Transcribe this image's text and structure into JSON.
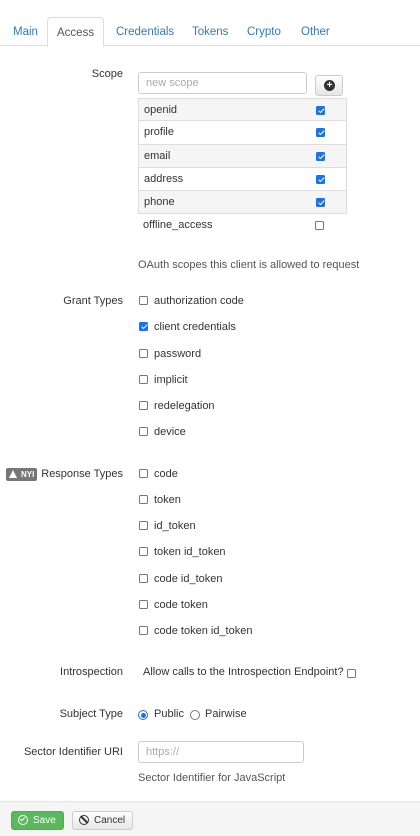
{
  "tabs": [
    {
      "label": "Main",
      "active": false
    },
    {
      "label": "Access",
      "active": true
    },
    {
      "label": "Credentials",
      "active": false
    },
    {
      "label": "Tokens",
      "active": false
    },
    {
      "label": "Crypto",
      "active": false
    },
    {
      "label": "Other",
      "active": false
    }
  ],
  "scope": {
    "label": "Scope",
    "placeholder": "new scope",
    "items": [
      {
        "name": "openid",
        "checked": true
      },
      {
        "name": "profile",
        "checked": true
      },
      {
        "name": "email",
        "checked": true
      },
      {
        "name": "address",
        "checked": true
      },
      {
        "name": "phone",
        "checked": true
      },
      {
        "name": "offline_access",
        "checked": false
      }
    ],
    "help": "OAuth scopes this client is allowed to request"
  },
  "grant_types": {
    "label": "Grant Types",
    "options": [
      {
        "label": "authorization code",
        "checked": false
      },
      {
        "label": "client credentials",
        "checked": true
      },
      {
        "label": "password",
        "checked": false
      },
      {
        "label": "implicit",
        "checked": false
      },
      {
        "label": "redelegation",
        "checked": false
      },
      {
        "label": "device",
        "checked": false
      }
    ]
  },
  "response_types": {
    "badge": "NYI",
    "label": "Response Types",
    "options": [
      {
        "label": "code",
        "checked": false
      },
      {
        "label": "token",
        "checked": false
      },
      {
        "label": "id_token",
        "checked": false
      },
      {
        "label": "token id_token",
        "checked": false
      },
      {
        "label": "code id_token",
        "checked": false
      },
      {
        "label": "code token",
        "checked": false
      },
      {
        "label": "code token id_token",
        "checked": false
      }
    ]
  },
  "introspection": {
    "label": "Introspection",
    "option_label": "Allow calls to the Introspection Endpoint?",
    "checked": false
  },
  "subject_type": {
    "label": "Subject Type",
    "options": [
      {
        "label": "Public",
        "selected": true
      },
      {
        "label": "Pairwise",
        "selected": false
      }
    ]
  },
  "sector_identifier": {
    "label": "Sector Identifier URI",
    "placeholder": "https://",
    "help": "Sector Identifier for JavaScript"
  },
  "footer": {
    "save_label": "Save",
    "cancel_label": "Cancel"
  },
  "colors": {
    "link": "#337ab7",
    "check": "#1a73e8",
    "save": "#5cb85c"
  }
}
